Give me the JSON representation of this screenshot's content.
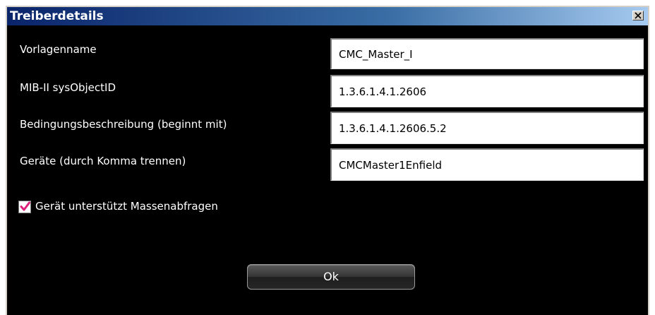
{
  "window": {
    "title": "Treiberdetails"
  },
  "fields": [
    {
      "label": "Vorlagenname",
      "value": "CMC_Master_I"
    },
    {
      "label": "MIB-II sysObjectID",
      "value": "1.3.6.1.4.1.2606"
    },
    {
      "label": "Bedingungsbeschreibung (beginnt mit)",
      "value": "1.3.6.1.4.1.2606.5.2"
    },
    {
      "label": "Geräte (durch Komma trennen)",
      "value": "CMCMaster1Enfield"
    }
  ],
  "bulk_query": {
    "label": "Gerät unterstützt Massenabfragen",
    "checked": true
  },
  "buttons": {
    "ok_label": "Ok"
  },
  "colors": {
    "background": "#000000",
    "check_color": "#e0207a",
    "title_gradient_start": "#0a246a"
  }
}
